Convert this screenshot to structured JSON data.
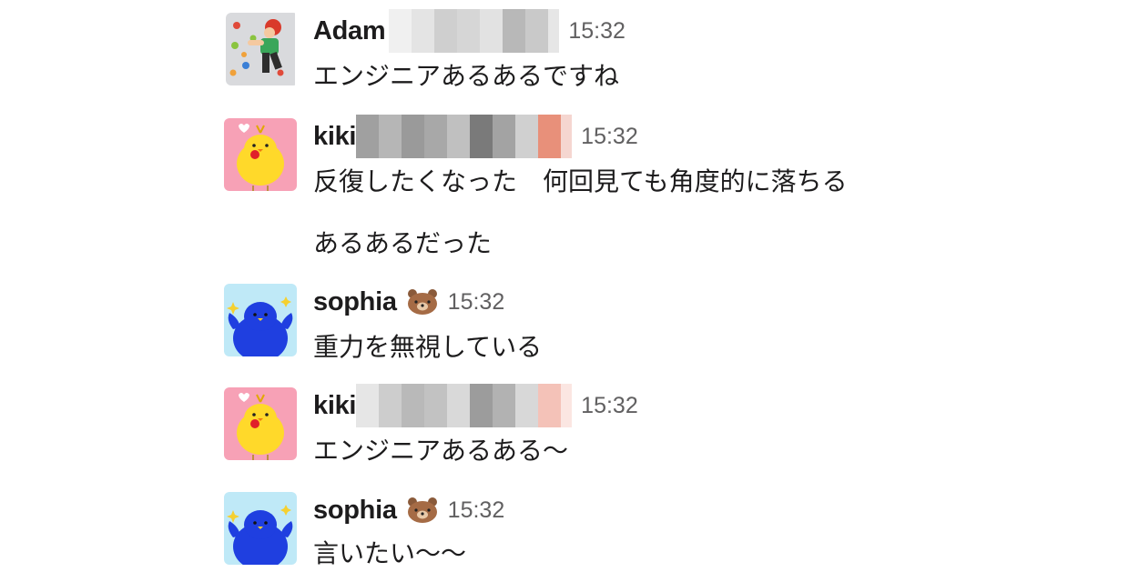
{
  "messages": [
    {
      "user": "Adam",
      "time": "15:32",
      "avatar_icon": "climber-avatar-icon",
      "lines": [
        "エンジニアあるあるですね"
      ]
    },
    {
      "user": "kiki",
      "time": "15:32",
      "avatar_icon": "yellow-chick-avatar-icon",
      "lines": [
        "反復したくなった　何回見ても角度的に落ちる",
        "あるあるだった"
      ]
    },
    {
      "user": "sophia",
      "time": "15:32",
      "status_emoji": "bear-face-icon",
      "avatar_icon": "blue-bird-avatar-icon",
      "lines": [
        "重力を無視している"
      ]
    },
    {
      "user": "kiki",
      "time": "15:32",
      "avatar_icon": "yellow-chick-avatar-icon",
      "lines": [
        "エンジニアあるある〜"
      ]
    },
    {
      "user": "sophia",
      "time": "15:32",
      "status_emoji": "bear-face-icon",
      "avatar_icon": "blue-bird-avatar-icon",
      "lines": [
        "言いたい〜〜"
      ]
    }
  ],
  "colors": {
    "chick_bg": "#f7a1b6",
    "bird_bg": "#bfe9f7",
    "bird": "#1f3fe0",
    "chick": "#ffd92a",
    "timestamp": "#616061",
    "text": "#1d1c1d"
  }
}
